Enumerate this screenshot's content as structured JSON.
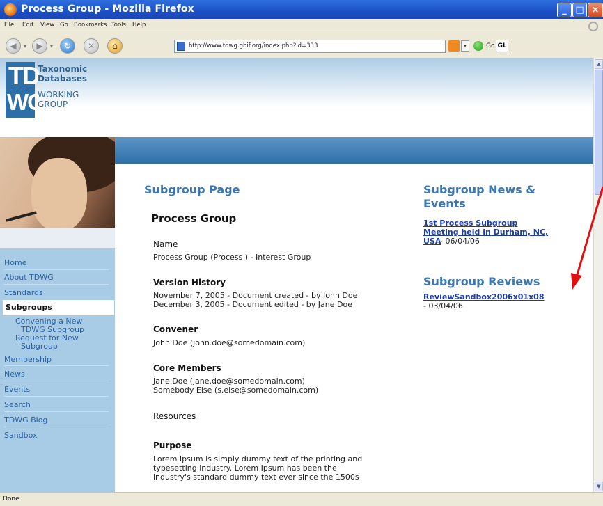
{
  "window": {
    "title": "Process Group - Mozilla Firefox"
  },
  "menu": [
    "File",
    "Edit",
    "View",
    "Go",
    "Bookmarks",
    "Tools",
    "Help"
  ],
  "nav": {
    "url": "http://www.tdwg.gbif.org/index.php?id=333",
    "go_label": "Go",
    "search_engine_label": "GL"
  },
  "logo": {
    "letters_top": "TD",
    "letters_bottom": "WG",
    "line1": "Taxonomic",
    "line2": "Databases",
    "line3": "WORKING",
    "line4": "GROUP"
  },
  "sidebar": {
    "items": [
      {
        "label": "Home"
      },
      {
        "label": "About TDWG"
      },
      {
        "label": "Standards"
      },
      {
        "label": "Subgroups",
        "selected": true
      },
      {
        "label": "Convening a New TDWG Subgroup"
      },
      {
        "label": "Request for New Subgroup"
      },
      {
        "label": "Membership"
      },
      {
        "label": "News"
      },
      {
        "label": "Events"
      },
      {
        "label": "Search"
      },
      {
        "label": "TDWG Blog"
      },
      {
        "label": "Sandbox"
      }
    ],
    "sub_lines": {
      "convening_1": "Convening a New",
      "convening_2": "TDWG Subgroup",
      "request_1": "Request for New",
      "request_2": "Subgroup"
    }
  },
  "main": {
    "page_heading": "Subgroup Page",
    "group_title": "Process Group",
    "name_label": "Name",
    "name_value": "Process Group (Process ) - Interest Group",
    "version_label": "Version History",
    "version_1": "November 7, 2005 - Document created - by John Doe",
    "version_2": "December 3, 2005 - Document edited - by Jane Doe",
    "convener_label": "Convener",
    "convener_value": "John Doe (john.doe@somedomain.com)",
    "core_label": "Core Members",
    "core_1": "Jane Doe (jane.doe@somedomain.com)",
    "core_2": "Somebody Else (s.else@somedomain.com)",
    "resources_label": "Resources",
    "purpose_label": "Purpose",
    "purpose_1": "Lorem Ipsum is simply dummy text of the printing and",
    "purpose_2": "typesetting industry. Lorem Ipsum has been the",
    "purpose_3": "industry's standard dummy text ever since the 1500s"
  },
  "side": {
    "news_heading_1": "Subgroup News &",
    "news_heading_2": "Events",
    "news_link_1": "1st Process Subgroup",
    "news_link_2": "Meeting held in Durham, NC,",
    "news_link_3": "USA",
    "news_date": " - 06/04/06",
    "reviews_heading": "Subgroup Reviews",
    "review_link": "ReviewSandbox2006x01x08",
    "review_date": "- 03/04/06"
  },
  "status": {
    "text": "Done"
  },
  "colors": {
    "accent": "#3a78b4",
    "nav_bg": "#a9cce6",
    "link": "#1a3ca8",
    "annotation_arrow": "#e01010"
  }
}
